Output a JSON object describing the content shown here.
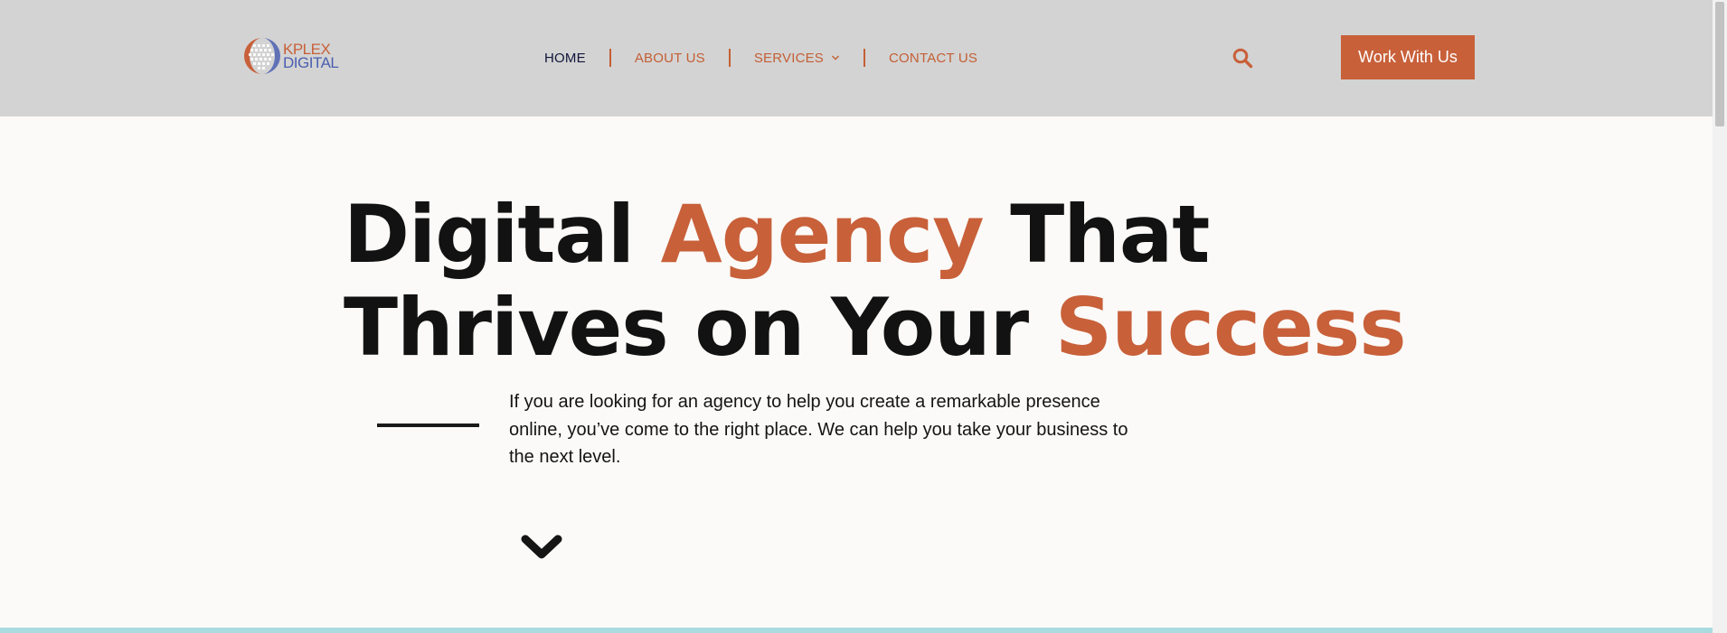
{
  "header": {
    "logo": {
      "line1": "KPLEX",
      "line2": "DIGITAL"
    },
    "nav": [
      {
        "label": "HOME",
        "active": true
      },
      {
        "label": "ABOUT US",
        "active": false
      },
      {
        "label": "SERVICES",
        "active": false,
        "has_dropdown": true
      },
      {
        "label": "CONTACT US",
        "active": false
      }
    ],
    "search_icon": "search-icon",
    "cta_label": "Work With Us"
  },
  "hero": {
    "title_line1": {
      "w1": "Digital",
      "w2": "Agency",
      "w3": "That"
    },
    "title_line2": {
      "w1": "Thrives on Your",
      "w2": "Success"
    },
    "description": "If you are looking for an agency to help you create a remarkable presence online, you’ve come to the right place. We can help you take your business to the next level.",
    "scroll_icon": "chevron-down-icon"
  },
  "colors": {
    "accent": "#c8603a",
    "header_bg": "#d3d3d3",
    "page_bg": "#fbfaf8",
    "nav_active": "#10163a",
    "strip": "#a9dbe0"
  }
}
